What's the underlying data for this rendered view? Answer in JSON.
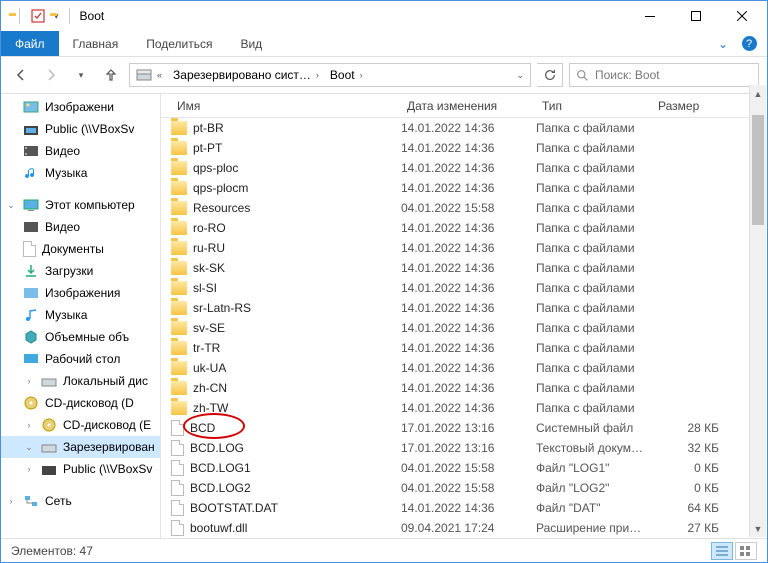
{
  "window": {
    "title": "Boot",
    "status": "Элементов: 47"
  },
  "tabs": {
    "file": "Файл",
    "home": "Главная",
    "share": "Поделиться",
    "view": "Вид"
  },
  "breadcrumb": {
    "p1": "Зарезервировано сист…",
    "p2": "Boot"
  },
  "search": {
    "placeholder": "Поиск: Boot"
  },
  "columns": {
    "name": "Имя",
    "date": "Дата изменения",
    "type": "Тип",
    "size": "Размер"
  },
  "nav": {
    "imgs": "Изображени",
    "pub": "Public (\\\\VBoxSv",
    "video": "Видео",
    "music": "Музыка",
    "pc": "Этот компьютер",
    "video2": "Видео",
    "docs": "Документы",
    "dl": "Загрузки",
    "imgs2": "Изображения",
    "music2": "Музыка",
    "vol": "Объемные объ",
    "desk": "Рабочий стол",
    "ldisk": "Локальный дис",
    "cd1": "CD-дисковод (D",
    "cd2": "CD-дисковод (E",
    "res": "Зарезервирован",
    "pub2": "Public (\\\\VBoxSv",
    "net": "Сеть"
  },
  "files": [
    {
      "n": "pt-BR",
      "d": "14.01.2022 14:36",
      "t": "Папка с файлами",
      "s": "",
      "k": "f"
    },
    {
      "n": "pt-PT",
      "d": "14.01.2022 14:36",
      "t": "Папка с файлами",
      "s": "",
      "k": "f"
    },
    {
      "n": "qps-ploc",
      "d": "14.01.2022 14:36",
      "t": "Папка с файлами",
      "s": "",
      "k": "f"
    },
    {
      "n": "qps-plocm",
      "d": "14.01.2022 14:36",
      "t": "Папка с файлами",
      "s": "",
      "k": "f"
    },
    {
      "n": "Resources",
      "d": "04.01.2022 15:58",
      "t": "Папка с файлами",
      "s": "",
      "k": "f"
    },
    {
      "n": "ro-RO",
      "d": "14.01.2022 14:36",
      "t": "Папка с файлами",
      "s": "",
      "k": "f"
    },
    {
      "n": "ru-RU",
      "d": "14.01.2022 14:36",
      "t": "Папка с файлами",
      "s": "",
      "k": "f"
    },
    {
      "n": "sk-SK",
      "d": "14.01.2022 14:36",
      "t": "Папка с файлами",
      "s": "",
      "k": "f"
    },
    {
      "n": "sl-SI",
      "d": "14.01.2022 14:36",
      "t": "Папка с файлами",
      "s": "",
      "k": "f"
    },
    {
      "n": "sr-Latn-RS",
      "d": "14.01.2022 14:36",
      "t": "Папка с файлами",
      "s": "",
      "k": "f"
    },
    {
      "n": "sv-SE",
      "d": "14.01.2022 14:36",
      "t": "Папка с файлами",
      "s": "",
      "k": "f"
    },
    {
      "n": "tr-TR",
      "d": "14.01.2022 14:36",
      "t": "Папка с файлами",
      "s": "",
      "k": "f"
    },
    {
      "n": "uk-UA",
      "d": "14.01.2022 14:36",
      "t": "Папка с файлами",
      "s": "",
      "k": "f"
    },
    {
      "n": "zh-CN",
      "d": "14.01.2022 14:36",
      "t": "Папка с файлами",
      "s": "",
      "k": "f"
    },
    {
      "n": "zh-TW",
      "d": "14.01.2022 14:36",
      "t": "Папка с файлами",
      "s": "",
      "k": "f"
    },
    {
      "n": "BCD",
      "d": "17.01.2022 13:16",
      "t": "Системный файл",
      "s": "28 КБ",
      "k": "d"
    },
    {
      "n": "BCD.LOG",
      "d": "17.01.2022 13:16",
      "t": "Текстовый докум…",
      "s": "32 КБ",
      "k": "d"
    },
    {
      "n": "BCD.LOG1",
      "d": "04.01.2022 15:58",
      "t": "Файл \"LOG1\"",
      "s": "0 КБ",
      "k": "d"
    },
    {
      "n": "BCD.LOG2",
      "d": "04.01.2022 15:58",
      "t": "Файл \"LOG2\"",
      "s": "0 КБ",
      "k": "d"
    },
    {
      "n": "BOOTSTAT.DAT",
      "d": "14.01.2022 14:36",
      "t": "Файл \"DAT\"",
      "s": "64 КБ",
      "k": "d"
    },
    {
      "n": "bootuwf.dll",
      "d": "09.04.2021 17:24",
      "t": "Расширение при…",
      "s": "27 КБ",
      "k": "d"
    }
  ]
}
